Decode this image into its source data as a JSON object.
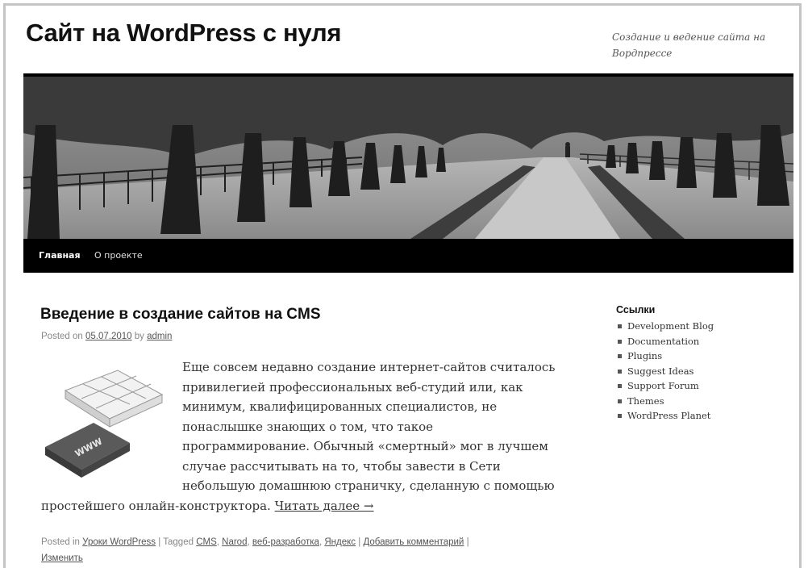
{
  "site": {
    "title": "Сайт на WordPress с нуля",
    "description": "Создание и ведение сайта на Вордпрессе"
  },
  "nav": {
    "items": [
      {
        "label": "Главная"
      },
      {
        "label": "О проекте"
      }
    ]
  },
  "post": {
    "title": "Введение в создание сайтов на CMS",
    "meta": {
      "posted_on": "Posted on",
      "date": "05.07.2010",
      "by": "by",
      "author": "admin"
    },
    "thumbnail_text": "WWW",
    "excerpt": "Еще совсем недавно создание интернет-сайтов считалось привилегией профессиональных веб-студий или, как минимум, квалифицированных специалистов, не понаслышке знающих о том, что такое программирование. Обычный «смертный» мог в лучшем случае рассчитывать на то, чтобы завести в Сети небольшую домашнюю страничку, сделанную с помощью простейшего онлайн-конструктора.",
    "read_more": "Читать далее →",
    "footer": {
      "posted_in": "Posted in",
      "category": "Уроки WordPress",
      "sep1": "|",
      "tagged": "Tagged",
      "tags": [
        "CMS",
        "Narod",
        "веб-разработка",
        "Яндекс"
      ],
      "sep2": "|",
      "add_comment": "Добавить комментарий",
      "sep3": "|",
      "edit": "Изменить"
    }
  },
  "sidebar": {
    "heading": "Ссылки",
    "links": [
      {
        "label": "Development Blog"
      },
      {
        "label": "Documentation"
      },
      {
        "label": "Plugins"
      },
      {
        "label": "Suggest Ideas"
      },
      {
        "label": "Support Forum"
      },
      {
        "label": "Themes"
      },
      {
        "label": "WordPress Planet"
      }
    ]
  }
}
